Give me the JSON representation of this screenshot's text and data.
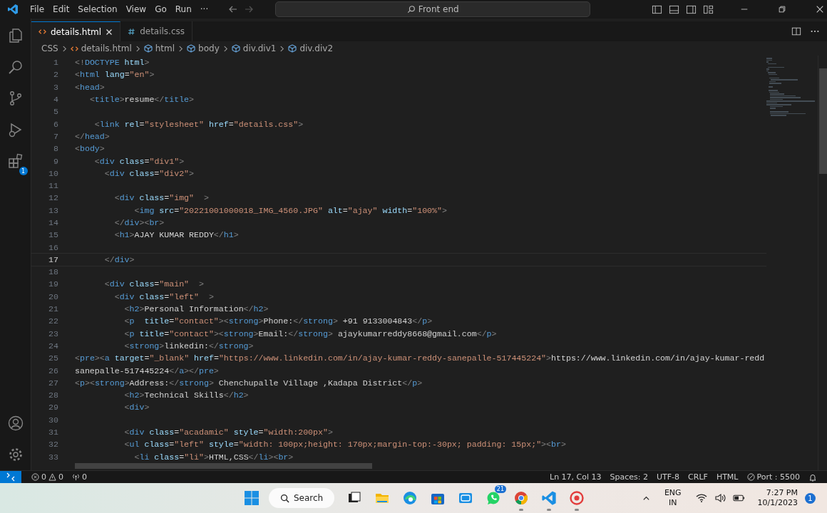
{
  "title_bar": {
    "menus": [
      "File",
      "Edit",
      "Selection",
      "View",
      "Go",
      "Run",
      "···"
    ],
    "search": "Front end"
  },
  "activity_bar": {
    "extensions_badge": "1"
  },
  "tabs": [
    {
      "label": "details.html",
      "kind": "html",
      "selected": true
    },
    {
      "label": "details.css",
      "kind": "css",
      "selected": false
    }
  ],
  "breadcrumb": [
    {
      "label": "CSS",
      "kind": "folder"
    },
    {
      "label": "details.html",
      "kind": "html"
    },
    {
      "label": "html",
      "kind": "element"
    },
    {
      "label": "body",
      "kind": "element"
    },
    {
      "label": "div.div1",
      "kind": "element"
    },
    {
      "label": "div.div2",
      "kind": "element"
    }
  ],
  "editor": {
    "lines": [
      {
        "number": "1",
        "code": "<!DOCTYPE html>",
        "current": false
      },
      {
        "number": "2",
        "code": "<html lang=\"en\">",
        "current": false
      },
      {
        "number": "3",
        "code": "<head>",
        "current": false
      },
      {
        "number": "4",
        "code": "   <title>resume</title>",
        "current": false
      },
      {
        "number": "5",
        "current": false
      },
      {
        "number": "6",
        "code": "    <link rel=\"stylesheet\" href=\"details.css\">",
        "current": false
      },
      {
        "number": "7",
        "code": "</head>",
        "current": false
      },
      {
        "number": "8",
        "code": "<body>",
        "current": false
      },
      {
        "number": "9",
        "code": "    <div class=\"div1\">",
        "current": false
      },
      {
        "number": "10",
        "code": "      <div class=\"div2\">",
        "current": false
      },
      {
        "number": "11",
        "current": false
      },
      {
        "number": "12",
        "code": "        <div class=\"img\"  >",
        "current": false
      },
      {
        "number": "13",
        "code": "            <img src=\"20221001000018_IMG_4560.JPG\" alt=\"ajay\" width=\"100%\">",
        "current": false
      },
      {
        "number": "14",
        "code": "        </div><br>",
        "current": false
      },
      {
        "number": "15",
        "code": "        <h1>AJAY KUMAR REDDY</h1>",
        "current": false
      },
      {
        "number": "16",
        "current": false
      },
      {
        "number": "17",
        "code": "      </div>",
        "current": true
      },
      {
        "number": "18",
        "current": false
      },
      {
        "number": "19",
        "code": "      <div class=\"main\"  >",
        "current": false
      },
      {
        "number": "20",
        "code": "        <div class=\"left\"  >",
        "current": false
      },
      {
        "number": "21",
        "code": "          <h2>Personal Information</h2>",
        "current": false
      },
      {
        "number": "22",
        "code": "          <p  title=\"contact\"><strong>Phone:</strong> +91 9133004843</p>",
        "current": false
      },
      {
        "number": "23",
        "code": "          <p title=\"contact\"><strong>Email:</strong> ajaykumarreddy8668@gmail.com</p>",
        "current": false
      },
      {
        "number": "24",
        "code": "          <strong>linkedin:</strong>",
        "current": false
      },
      {
        "number": "25",
        "code": "<pre><a target=\"_blank\" href=\"https://www.linkedin.com/in/ajay-kumar-reddy-sanepalle-517445224\">https://www.linkedin.com/in/ajay-kumar-redd",
        "current": false
      },
      {
        "number": "26",
        "code": "sanepalle-517445224</a></pre>",
        "current": false
      },
      {
        "number": "27",
        "code": "<p><strong>Address:</strong> Chenchupalle Village ,Kadapa District</p>",
        "current": false
      },
      {
        "number": "28",
        "code": "          <h2>Technical Skills</h2>",
        "current": false
      },
      {
        "number": "29",
        "code": "          <div>",
        "current": false
      },
      {
        "number": "30",
        "current": false
      },
      {
        "number": "31",
        "code": "          <div class=\"acadamic\" style=\"width:200px\">",
        "current": false
      },
      {
        "number": "32",
        "code": "          <ul class=\"left\" style=\"width: 100px;height: 170px;margin-top:-30px; padding: 15px;\"><br>",
        "current": false
      },
      {
        "number": "33",
        "code": "            <li class=\"li\">HTML,CSS</li><br>",
        "current": false
      }
    ]
  },
  "status_bar": {
    "errors": "0",
    "warnings": "0",
    "ports": "0",
    "items": [
      "Ln 17, Col 13",
      "Spaces: 2",
      "UTF-8",
      "CRLF",
      "HTML"
    ],
    "port": "Port : 5500"
  },
  "taskbar": {
    "search": "Search",
    "apps": [
      {
        "kind": "task-view",
        "running": false
      },
      {
        "kind": "files",
        "running": false
      },
      {
        "kind": "edge",
        "running": false
      },
      {
        "kind": "store",
        "running": false
      },
      {
        "kind": "mail",
        "running": false
      },
      {
        "kind": "whatsapp",
        "running": false,
        "badge": "21"
      },
      {
        "kind": "chrome",
        "running": true
      },
      {
        "kind": "vscode",
        "running": true
      },
      {
        "kind": "recorder",
        "running": true
      }
    ],
    "language": [
      "ENG",
      "IN"
    ],
    "time": "7:27 PM",
    "date": "10/1/2023",
    "notifications": "1"
  }
}
